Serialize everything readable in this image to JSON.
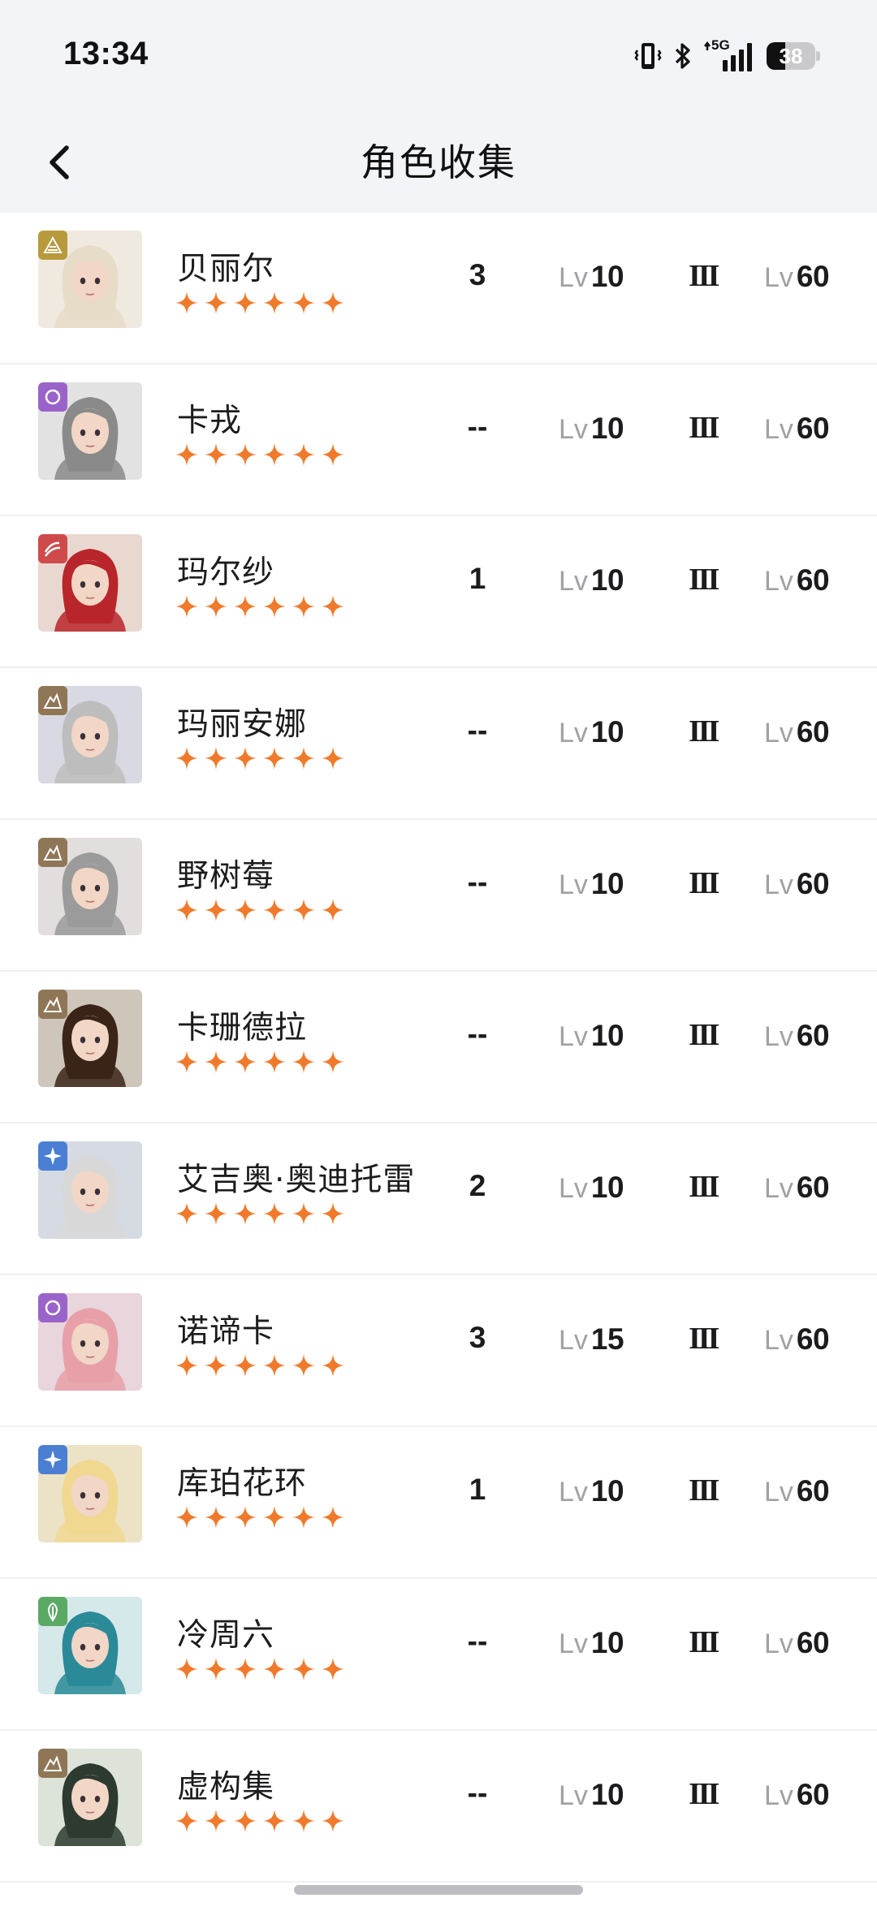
{
  "status_bar": {
    "time": "13:34",
    "network_label": "5G",
    "battery_level": "38",
    "battery_fraction": 0.38,
    "icons": [
      "vibrate-icon",
      "bluetooth-icon",
      "signal-icon",
      "battery-icon"
    ]
  },
  "header": {
    "title": "角色收集",
    "back_icon": "chevron-left-icon"
  },
  "colors": {
    "star": "#f07a2c",
    "elements": {
      "earth": "#b89a3c",
      "void": "#9a63c9",
      "fire": "#cf4a4a",
      "rock": "#8f7656",
      "wind": "#4a7fd3",
      "wood": "#5aaa64"
    }
  },
  "characters": [
    {
      "name": "贝丽尔",
      "element": "earth",
      "stars": 6,
      "constellation": "3",
      "skill_prefix": "Lv",
      "skill_level": "10",
      "rank": "III",
      "level_prefix": "Lv",
      "level": "60"
    },
    {
      "name": "卡戎",
      "element": "void",
      "stars": 6,
      "constellation": "--",
      "skill_prefix": "Lv",
      "skill_level": "10",
      "rank": "III",
      "level_prefix": "Lv",
      "level": "60"
    },
    {
      "name": "玛尔纱",
      "element": "fire",
      "stars": 6,
      "constellation": "1",
      "skill_prefix": "Lv",
      "skill_level": "10",
      "rank": "III",
      "level_prefix": "Lv",
      "level": "60"
    },
    {
      "name": "玛丽安娜",
      "element": "rock",
      "stars": 6,
      "constellation": "--",
      "skill_prefix": "Lv",
      "skill_level": "10",
      "rank": "III",
      "level_prefix": "Lv",
      "level": "60"
    },
    {
      "name": "野树莓",
      "element": "rock",
      "stars": 6,
      "constellation": "--",
      "skill_prefix": "Lv",
      "skill_level": "10",
      "rank": "III",
      "level_prefix": "Lv",
      "level": "60"
    },
    {
      "name": "卡珊德拉",
      "element": "rock",
      "stars": 6,
      "constellation": "--",
      "skill_prefix": "Lv",
      "skill_level": "10",
      "rank": "III",
      "level_prefix": "Lv",
      "level": "60"
    },
    {
      "name": "艾吉奥·奥迪托雷",
      "element": "wind",
      "stars": 6,
      "constellation": "2",
      "skill_prefix": "Lv",
      "skill_level": "10",
      "rank": "III",
      "level_prefix": "Lv",
      "level": "60"
    },
    {
      "name": "诺谛卡",
      "element": "void",
      "stars": 6,
      "constellation": "3",
      "skill_prefix": "Lv",
      "skill_level": "15",
      "rank": "III",
      "level_prefix": "Lv",
      "level": "60"
    },
    {
      "name": "库珀花环",
      "element": "wind",
      "stars": 6,
      "constellation": "1",
      "skill_prefix": "Lv",
      "skill_level": "10",
      "rank": "III",
      "level_prefix": "Lv",
      "level": "60"
    },
    {
      "name": "冷周六",
      "element": "wood",
      "stars": 6,
      "constellation": "--",
      "skill_prefix": "Lv",
      "skill_level": "10",
      "rank": "III",
      "level_prefix": "Lv",
      "level": "60"
    },
    {
      "name": "虚构集",
      "element": "rock",
      "stars": 6,
      "constellation": "--",
      "skill_prefix": "Lv",
      "skill_level": "10",
      "rank": "III",
      "level_prefix": "Lv",
      "level": "60"
    }
  ]
}
